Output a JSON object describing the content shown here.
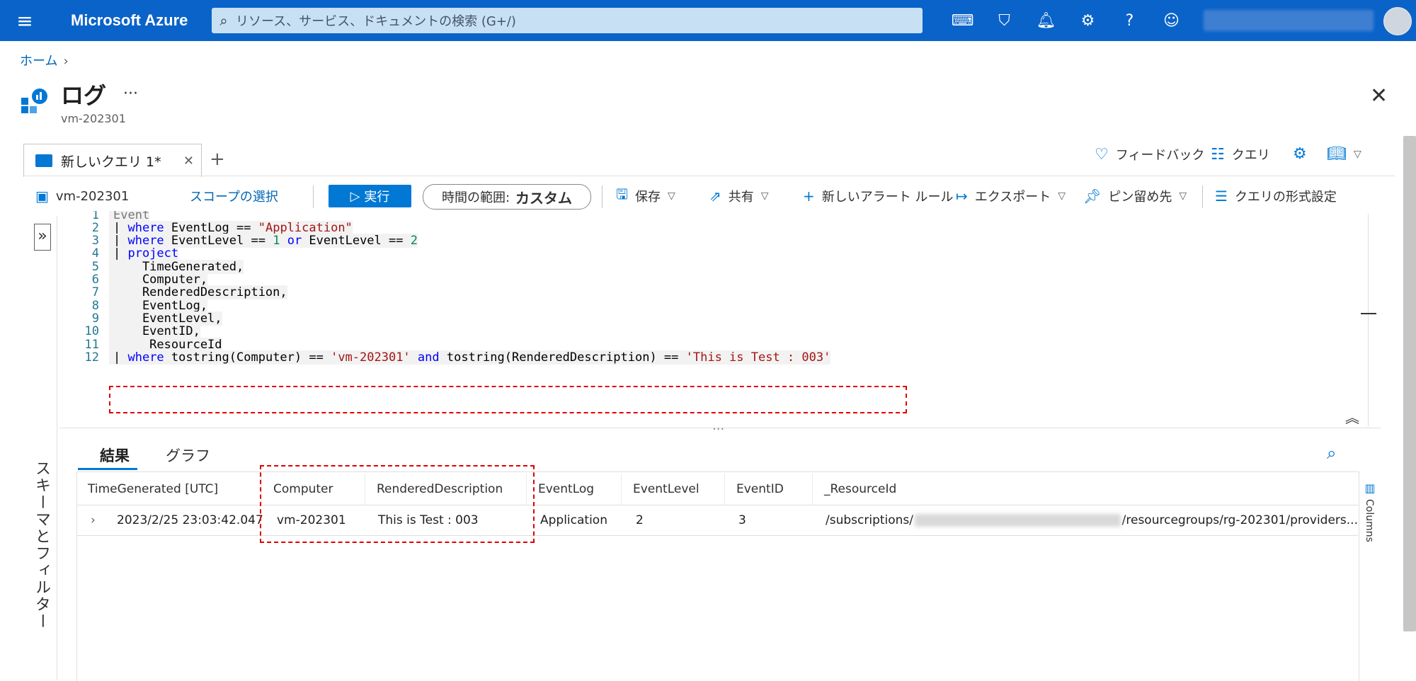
{
  "topbar": {
    "brand": "Microsoft Azure",
    "search_placeholder": "リソース、サービス、ドキュメントの検索 (G+/)"
  },
  "breadcrumb": {
    "home": "ホーム"
  },
  "page": {
    "title": "ログ",
    "subtitle": "vm-202301",
    "more": "···"
  },
  "tabs": {
    "query_tab": "新しいクエリ 1*"
  },
  "right_tools": {
    "feedback": "フィードバック",
    "queries": "クエリ"
  },
  "toolbar": {
    "scope_name": "vm-202301",
    "scope_select": "スコープの選択",
    "run": "実行",
    "time_range_label": "時間の範囲:",
    "time_range_value": "カスタム",
    "save": "保存",
    "share": "共有",
    "new_alert": "新しいアラート ルール",
    "export": "エクスポート",
    "pin": "ピン留め先",
    "format": "クエリの形式設定"
  },
  "side_panel": {
    "label": "スキーマとフィルター"
  },
  "editor": {
    "lines": [
      {
        "n": "1",
        "a": "Event"
      },
      {
        "n": "2",
        "a": "| ",
        "b": "where",
        "c": " EventLog == ",
        "d": "\"Application\""
      },
      {
        "n": "3",
        "a": "| ",
        "b": "where",
        "c": " EventLevel == ",
        "d": "1",
        "e": " ",
        "f": "or",
        "g": " EventLevel == ",
        "h": "2"
      },
      {
        "n": "4",
        "a": "| ",
        "b": "project"
      },
      {
        "n": "5",
        "a": "    TimeGenerated,"
      },
      {
        "n": "6",
        "a": "    Computer,"
      },
      {
        "n": "7",
        "a": "    RenderedDescription,"
      },
      {
        "n": "8",
        "a": "    EventLog,"
      },
      {
        "n": "9",
        "a": "    EventLevel,"
      },
      {
        "n": "10",
        "a": "    EventID,"
      },
      {
        "n": "11",
        "a": "    _ResourceId"
      },
      {
        "n": "12",
        "a": "| ",
        "b": "where",
        "c": " tostring(Computer) == ",
        "d": "'vm-202301'",
        "e": " ",
        "f": "and",
        "g": " tostring(RenderedDescription) == ",
        "h": "'This is Test : 003'"
      }
    ]
  },
  "results": {
    "tabs": [
      "結果",
      "グラフ"
    ],
    "columns": [
      "TimeGenerated [UTC]",
      "Computer",
      "RenderedDescription",
      "EventLog",
      "EventLevel",
      "EventID",
      "_ResourceId"
    ],
    "rows": [
      {
        "time": "2023/2/25 23:03:42.047",
        "computer": "vm-202301",
        "description": "This is Test : 003",
        "eventlog": "Application",
        "level": "2",
        "eventid": "3",
        "resource_pre": "/subscriptions/",
        "resource_post": "/resourcegroups/rg-202301/providers..."
      }
    ],
    "columns_panel": "Columns"
  }
}
